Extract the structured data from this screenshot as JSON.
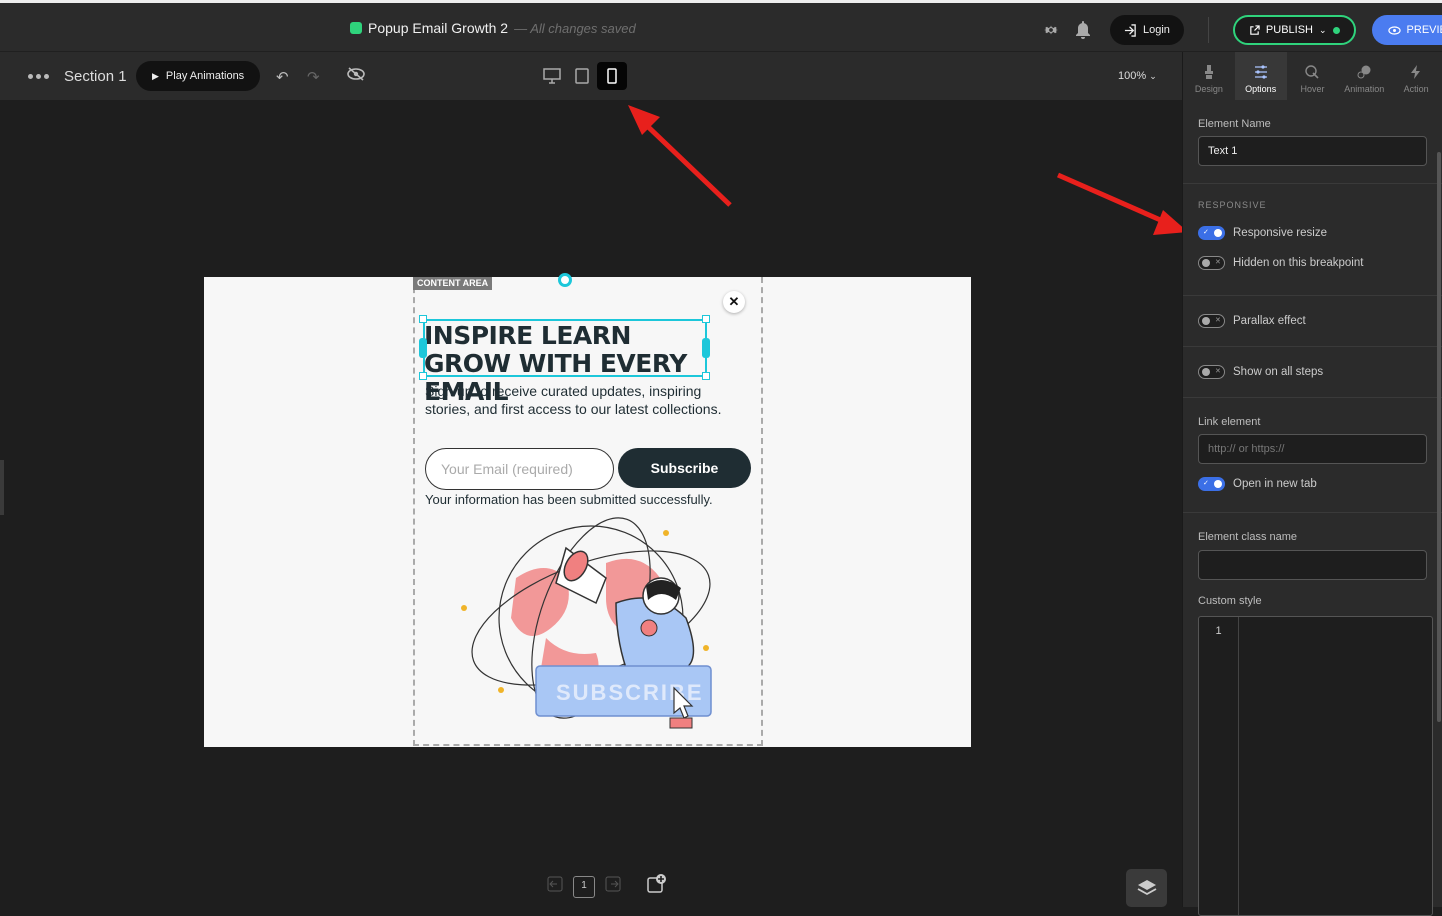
{
  "topbar": {
    "title": "Popup Email Growth 2",
    "saved_status": "— All changes saved",
    "login_label": "Login",
    "publish_label": "PUBLISH",
    "preview_label": "PREVIEW"
  },
  "toolbar": {
    "section_label": "Section 1",
    "play_label": "Play Animations",
    "zoom_label": "100%",
    "active_device": "mobile"
  },
  "panel": {
    "tabs": [
      {
        "label": "Design",
        "icon": "brush-icon"
      },
      {
        "label": "Options",
        "icon": "sliders-icon"
      },
      {
        "label": "Hover",
        "icon": "hover-icon"
      },
      {
        "label": "Animation",
        "icon": "animation-icon"
      },
      {
        "label": "Action",
        "icon": "bolt-icon"
      }
    ],
    "active_tab": "Options",
    "element_name_label": "Element Name",
    "element_name_value": "Text 1",
    "responsive_heading": "RESPONSIVE",
    "toggles": {
      "responsive_resize": {
        "label": "Responsive resize",
        "on": true
      },
      "hidden_breakpoint": {
        "label": "Hidden on this breakpoint",
        "on": false
      },
      "parallax": {
        "label": "Parallax effect",
        "on": false
      },
      "show_all_steps": {
        "label": "Show on all steps",
        "on": false
      },
      "open_new_tab": {
        "label": "Open in new tab",
        "on": true
      }
    },
    "link_label": "Link element",
    "link_placeholder": "http:// or https://",
    "class_label": "Element class name",
    "custom_style_label": "Custom style",
    "line_number": "1"
  },
  "popup": {
    "content_area_tag": "CONTENT AREA",
    "headline": "INSPIRE LEARN GROW WITH EVERY EMAIL",
    "body": "Sign up to receive curated updates, inspiring stories, and first access to our latest collections.",
    "email_placeholder": "Your Email (required)",
    "subscribe_label": "Subscribe",
    "success_message": "Your information has been submitted successfully.",
    "illustration_button_text": "SUBSCRIBE"
  },
  "bottom_nav": {
    "page_number": "1"
  },
  "colors": {
    "accent": "#1cc7da",
    "publish_green": "#2fd37c",
    "preview_blue": "#4b7cf0",
    "annotation_red": "#e8201c",
    "headline_dark": "#1f2d33"
  }
}
